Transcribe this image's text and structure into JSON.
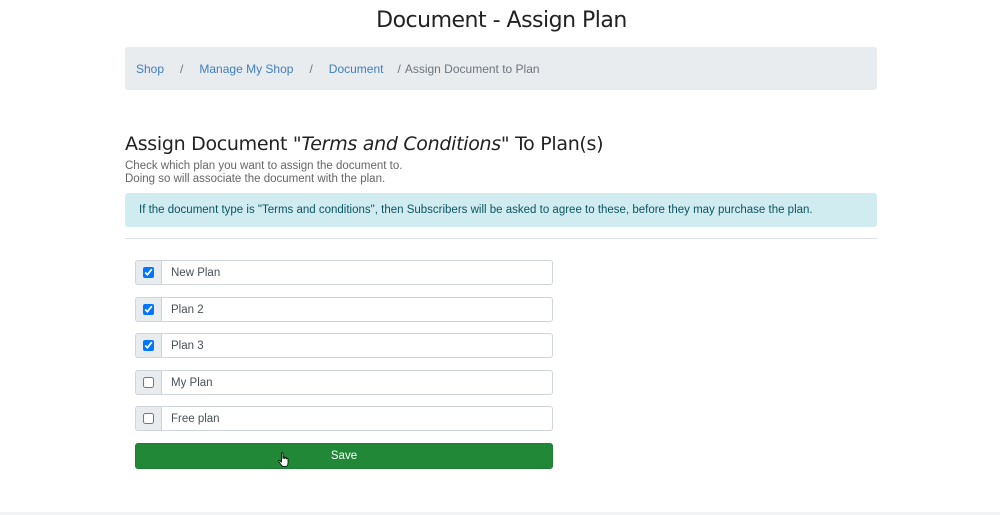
{
  "page": {
    "title": "Document - Assign Plan"
  },
  "breadcrumb": {
    "items": [
      "Shop",
      "Manage My Shop",
      "Document"
    ],
    "separator": "/",
    "current": "Assign Document to Plan"
  },
  "assign": {
    "heading_prefix": "Assign Document \"",
    "document_name": "Terms and Conditions",
    "heading_suffix": "\" To Plan(s)",
    "desc_line1": "Check which plan you want to assign the document to.",
    "desc_line2": "Doing so will associate the document with the plan.",
    "info": "If the document type is \"Terms and conditions\", then Subscribers will be asked to agree to these, before they may purchase the plan."
  },
  "plans": [
    {
      "name": "New Plan",
      "checked": true
    },
    {
      "name": "Plan 2",
      "checked": true
    },
    {
      "name": "Plan 3",
      "checked": true
    },
    {
      "name": "My Plan",
      "checked": false
    },
    {
      "name": "Free plan",
      "checked": false
    }
  ],
  "save_label": "Save",
  "colors": {
    "accent": "#3f7fbf",
    "save": "#218838",
    "info_bg": "#d1ecf1",
    "info_text": "#0c5460",
    "breadcrumb_bg": "#e9ecef"
  },
  "icons": {
    "cursor": "hand-pointer-icon"
  }
}
